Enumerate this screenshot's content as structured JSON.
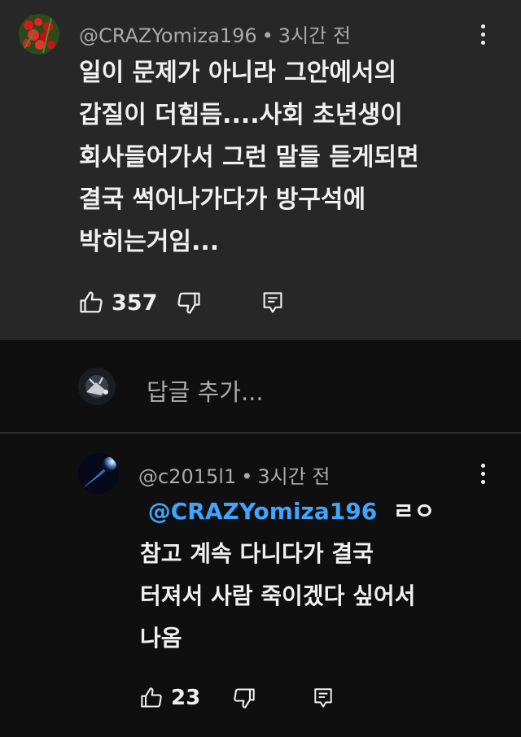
{
  "comment": {
    "author": "@CRAZYomiza196",
    "time": "3시간 전",
    "lines": [
      "일이 문제가 아니라 그안에서의",
      "갑질이 더힘듬....사회 초년생이",
      "회사들어가서 그런 말들 듣게되면",
      "결국 썩어나가다가 방구석에",
      "박히는거임..."
    ],
    "likes": "357"
  },
  "reply_input": {
    "placeholder": "답글 추가..."
  },
  "reply": {
    "author": "@c2015l1",
    "time": "3시간 전",
    "mention": "@CRAZYomiza196",
    "mention_suffix": "ㄹㅇ",
    "lines": [
      "참고 계속 다니다가 결국",
      "터져서 사람 죽이겠다 싶어서",
      "나옴"
    ],
    "likes": "23"
  },
  "colors": {
    "background": "#0f0f0f",
    "card": "#272727",
    "text": "#f1f1f1",
    "muted": "#aaaaaa",
    "mention": "#3ea6ff"
  },
  "icons": [
    "thumbs-up-icon",
    "thumbs-down-icon",
    "reply-icon",
    "more-vert-icon"
  ]
}
